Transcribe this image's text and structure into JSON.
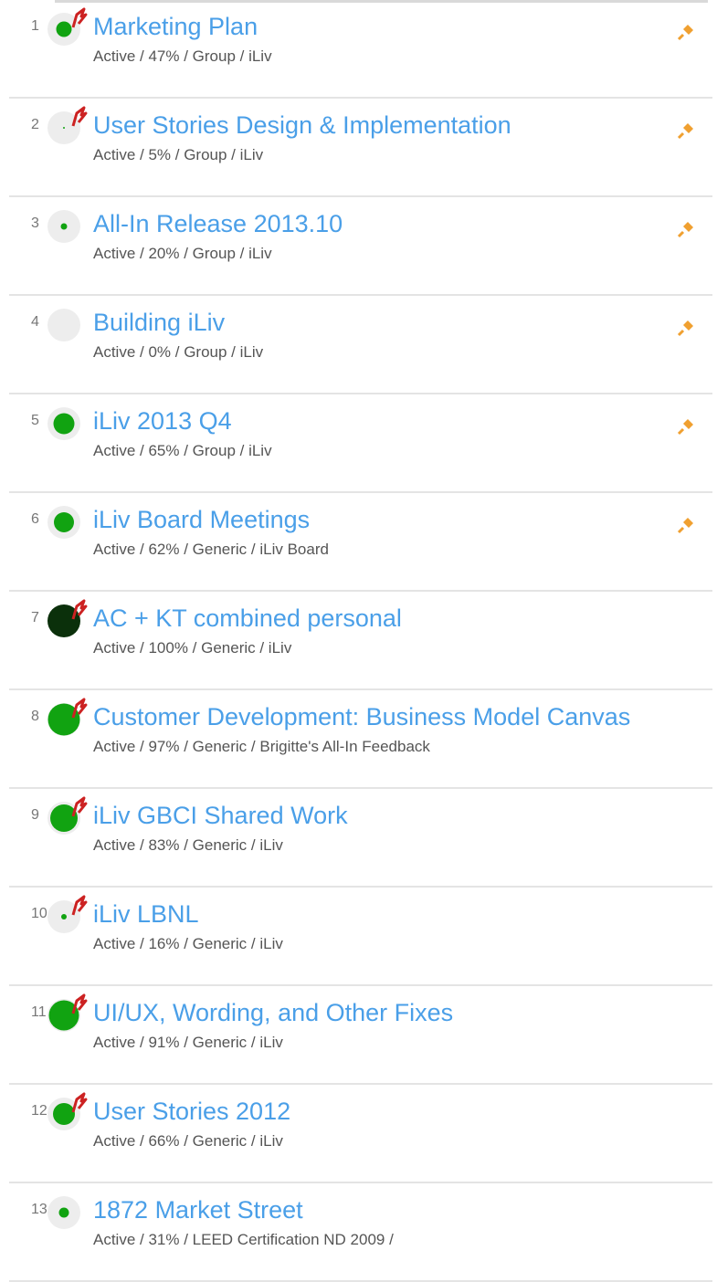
{
  "projects": [
    {
      "index": "1",
      "title": "Marketing Plan",
      "meta": "Active / 47% / Group / iLiv",
      "progress": 47,
      "flagged": true,
      "pinned": true
    },
    {
      "index": "2",
      "title": "User Stories Design & Implementation",
      "meta": "Active / 5% / Group / iLiv",
      "progress": 5,
      "flagged": true,
      "pinned": true
    },
    {
      "index": "3",
      "title": "All-In Release 2013.10",
      "meta": "Active / 20% / Group / iLiv",
      "progress": 20,
      "flagged": false,
      "pinned": true
    },
    {
      "index": "4",
      "title": "Building iLiv",
      "meta": "Active / 0% / Group / iLiv",
      "progress": 0,
      "flagged": false,
      "pinned": true
    },
    {
      "index": "5",
      "title": "iLiv 2013 Q4",
      "meta": "Active / 65% / Group / iLiv",
      "progress": 65,
      "flagged": false,
      "pinned": true
    },
    {
      "index": "6",
      "title": "iLiv Board Meetings",
      "meta": "Active / 62% / Generic / iLiv Board",
      "progress": 62,
      "flagged": false,
      "pinned": true
    },
    {
      "index": "7",
      "title": "AC + KT combined personal",
      "meta": "Active / 100% / Generic / iLiv",
      "progress": 100,
      "flagged": true,
      "pinned": false
    },
    {
      "index": "8",
      "title": "Customer Development: Business Model Canvas",
      "meta": "Active / 97% / Generic / Brigitte's All-In Feedback",
      "progress": 97,
      "flagged": true,
      "pinned": false
    },
    {
      "index": "9",
      "title": "iLiv GBCI Shared Work",
      "meta": "Active / 83% / Generic / iLiv",
      "progress": 83,
      "flagged": true,
      "pinned": false
    },
    {
      "index": "10",
      "title": "iLiv LBNL",
      "meta": "Active / 16% / Generic / iLiv",
      "progress": 16,
      "flagged": true,
      "pinned": false
    },
    {
      "index": "11",
      "title": "UI/UX, Wording, and Other Fixes",
      "meta": "Active / 91% / Generic / iLiv",
      "progress": 91,
      "flagged": true,
      "pinned": false
    },
    {
      "index": "12",
      "title": "User Stories 2012",
      "meta": "Active / 66% / Generic / iLiv",
      "progress": 66,
      "flagged": true,
      "pinned": false
    },
    {
      "index": "13",
      "title": "1872 Market Street",
      "meta": "Active / 31% / LEED Certification ND 2009 /",
      "progress": 31,
      "flagged": false,
      "pinned": false
    }
  ],
  "colors": {
    "link": "#4a9fe8",
    "progress_fill": "#11a311",
    "progress_complete": "#0b300b",
    "flag": "#cc2222",
    "pin": "#f0a030"
  },
  "icons": {
    "flag": "red-flag-icon",
    "pin": "orange-pin-icon",
    "progress": "progress-circle-icon"
  }
}
